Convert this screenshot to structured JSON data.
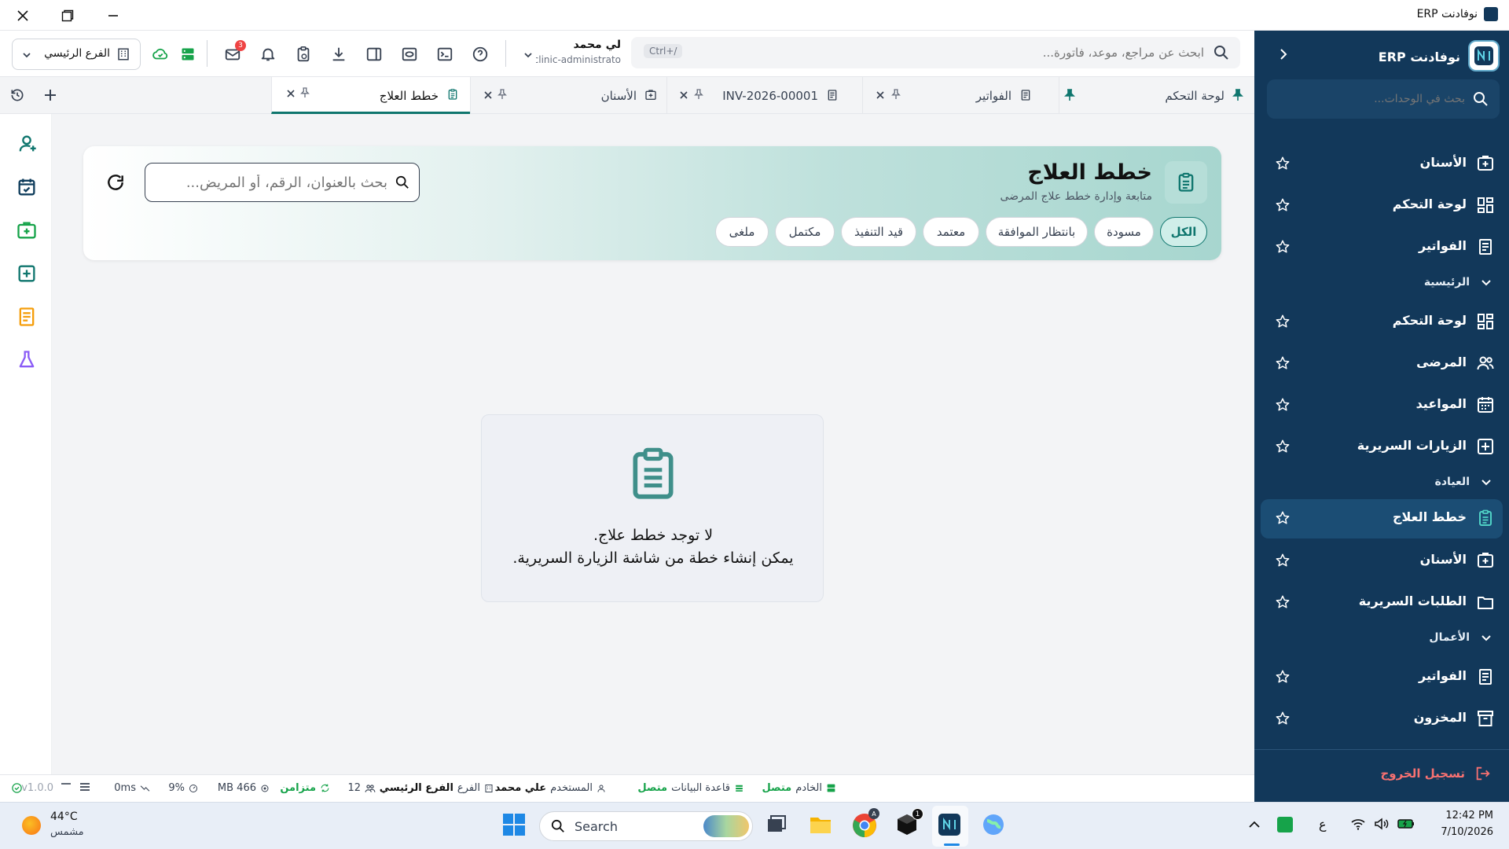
{
  "window": {
    "title": "نوفادنت ERP"
  },
  "sidebar": {
    "brand": "نوفادنت ERP",
    "search_placeholder": "بحث في الوحدات...",
    "items": [
      {
        "label": "الأسنان",
        "icon": "tooth-box-icon"
      },
      {
        "label": "لوحة التحكم",
        "icon": "dashboard-icon"
      },
      {
        "label": "الفواتير",
        "icon": "invoice-icon"
      },
      {
        "label": "الرئيسية",
        "section": true
      },
      {
        "label": "لوحة التحكم",
        "icon": "dashboard-icon"
      },
      {
        "label": "المرضى",
        "icon": "patients-icon"
      },
      {
        "label": "المواعيد",
        "icon": "calendar-icon"
      },
      {
        "label": "الزيارات السريرية",
        "icon": "plus-box-icon"
      },
      {
        "label": "العيادة",
        "section": true
      },
      {
        "label": "خطط العلاج",
        "icon": "clipboard-icon",
        "active": true
      },
      {
        "label": "الأسنان",
        "icon": "tooth-box-icon"
      },
      {
        "label": "الطلبات السريرية",
        "icon": "folder-icon"
      },
      {
        "label": "الأعمال",
        "section": true
      },
      {
        "label": "الفواتير",
        "icon": "invoice-icon"
      },
      {
        "label": "المخزون",
        "icon": "archive-icon"
      }
    ],
    "logout": "تسجيل الخروج"
  },
  "topbar": {
    "search_placeholder": "ابحث عن مراجع، موعد، فاتورة...",
    "shortcut": "Ctrl+/",
    "user_name": "لي محمد",
    "user_role": "clinic-administrato",
    "branch": "الفرع الرئيسي",
    "mail_badge": "3"
  },
  "tabs": [
    {
      "label": "لوحة التحكم"
    },
    {
      "label": "الفواتير"
    },
    {
      "label": "INV-2026-00001"
    },
    {
      "label": "الأسنان"
    },
    {
      "label": "خطط العلاج",
      "active": true
    }
  ],
  "page": {
    "title": "خطط العلاج",
    "subtitle": "متابعة وإدارة خطط علاج المرضى",
    "search_placeholder": "بحث بالعنوان، الرقم، أو المريض...",
    "filters": [
      "الكل",
      "مسودة",
      "بانتظار الموافقة",
      "معتمد",
      "قيد التنفيذ",
      "مكتمل",
      "ملغى"
    ],
    "active_filter": "الكل",
    "empty_line1": "لا توجد خطط علاج.",
    "empty_line2": "يمكن إنشاء خطة من شاشة الزيارة السريرية."
  },
  "status": {
    "server_label": "الخادم",
    "server_value": "متصل",
    "db_label": "قاعدة البيانات",
    "db_value": "متصل",
    "user_label": "المستخدم",
    "user_value": "علي محمد",
    "branch_label": "الفرع",
    "branch_value": "الفرع الرئيسي",
    "count": "12",
    "sync": "متزامن",
    "memory": "466 MB",
    "cpu": "9%",
    "latency": "0ms",
    "version": "v1.0.0"
  },
  "taskbar": {
    "temp": "44°C",
    "weather": "مشمس",
    "search": "Search",
    "time": "12:42 PM",
    "date": "7/10/2026",
    "lang": "ع",
    "notif_badge": "1"
  },
  "colors": {
    "sidebar": "#12385a",
    "accent": "#0f766e",
    "active_side": "#1b4d74",
    "green": "#16a34a"
  }
}
